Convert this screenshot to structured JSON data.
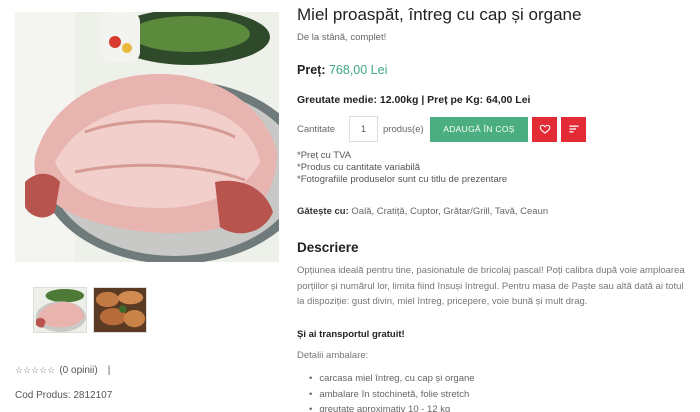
{
  "product": {
    "title": "Miel proaspăt, întreg cu cap și organe",
    "subtitle": "De la stână, complet!",
    "price_label": "Preț:",
    "price_value": "768,00 Lei",
    "weight_label": "Greutate medie:",
    "weight_value": "12.00kg | Preț pe Kg: 64,00 Lei",
    "quantity_label": "Cantitate",
    "quantity_value": "1",
    "quantity_unit": "produs(e)",
    "add_to_cart_label": "ADAUGĂ ÎN COȘ",
    "notes": [
      "*Preț cu TVA",
      "*Produs cu cantitate variabilă",
      "*Fotografiile produselor sunt cu titlu de prezentare"
    ],
    "cook_label": "Gătește cu:",
    "cook_value": "Oală, Cratiță, Cuptor, Grătar/Grill, Tavă, Ceaun"
  },
  "reviews": {
    "stars": "☆☆☆☆☆",
    "count_label": "(0 opinii)",
    "separator": "|"
  },
  "code": "Cod Produs: 2812107",
  "description": {
    "title": "Descriere",
    "text": "Opțiunea ideală pentru tine, pasionatule de bricolaj pascal! Poți calibra după voie amploarea porțiilor și numărul lor, limita fiind însuși întregul. Pentru masa de Paște sau altă dată ai totul la dispoziție: gust divin, miel întreg, pricepere, voie bună și mult drag.",
    "transport": "Și ai transportul gratuit!",
    "details_title": "Detalii ambalare:",
    "details": [
      "carcasa miel întreg, cu cap și organe",
      "ambalare în stochinetă, folie stretch",
      "greutate aproximativ  10 - 12 kg"
    ]
  },
  "icons": {
    "wishlist": "heart-icon",
    "compare": "list-icon"
  },
  "colors": {
    "accent_green": "#4aae80",
    "price_green": "#3fa886",
    "action_red": "#e32b35"
  }
}
